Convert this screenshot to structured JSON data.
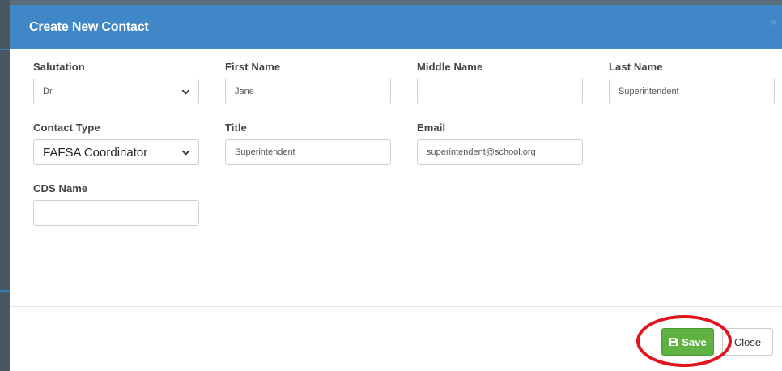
{
  "modal": {
    "title": "Create New Contact",
    "close_glyph": "×"
  },
  "form": {
    "salutation": {
      "label": "Salutation",
      "value": "Dr."
    },
    "first_name": {
      "label": "First Name",
      "value": "Jane"
    },
    "middle_name": {
      "label": "Middle Name",
      "value": ""
    },
    "last_name": {
      "label": "Last Name",
      "value": "Superintendent"
    },
    "contact_type": {
      "label": "Contact Type",
      "value": "FAFSA Coordinator"
    },
    "title": {
      "label": "Title",
      "value": "Superintendent"
    },
    "email": {
      "label": "Email",
      "value": "superintendent@school.org"
    },
    "cds_name": {
      "label": "CDS Name",
      "value": ""
    }
  },
  "footer": {
    "save_label": "Save",
    "close_label": "Close"
  },
  "icons": {
    "save": "floppy-disk-icon",
    "dropdown": "chevron-down-icon",
    "close": "close-icon"
  },
  "colors": {
    "header": "#3f87c7",
    "save_button": "#5fb142",
    "highlight": "#e2131c"
  }
}
